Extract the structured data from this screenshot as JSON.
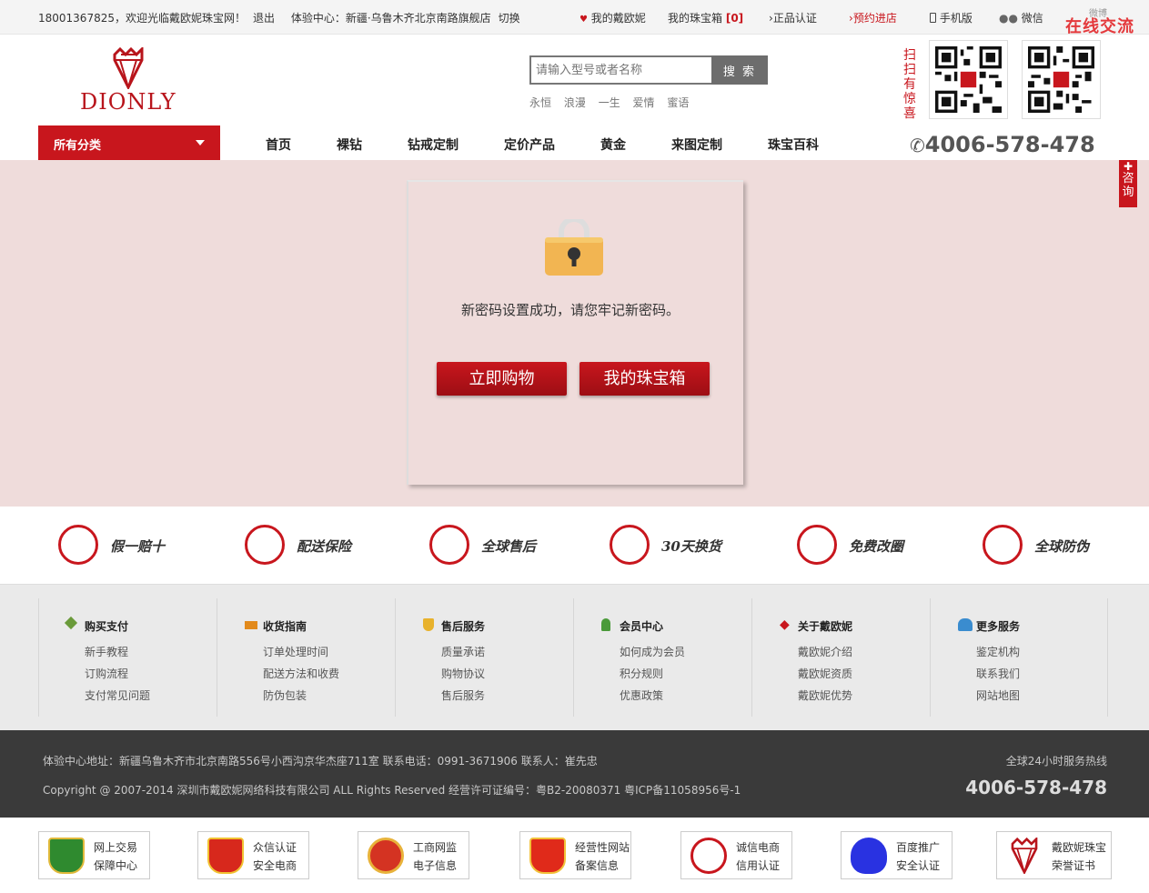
{
  "topbar": {
    "phone_user": "18001367825，欢迎光临戴欧妮珠宝网！",
    "logout": "退出",
    "experience": "体验中心：新疆·乌鲁木齐北京南路旗舰店",
    "switch": "切换",
    "my_dionly": "我的戴欧妮",
    "jewelry_box": "我的珠宝箱",
    "box_count": "[0]",
    "authentic": "正品认证",
    "appointment": "预约进店",
    "mobile": "手机版",
    "wechat": "微信",
    "weibo": "微博",
    "online_chat": "在线交流"
  },
  "header": {
    "logo_text": "DIONLY",
    "search_placeholder": "请输入型号或者名称",
    "search_button": "搜 索",
    "hot_words": [
      "永恒",
      "浪漫",
      "一生",
      "爱情",
      "蜜语"
    ],
    "scan_text": "扫扫有惊喜"
  },
  "nav": {
    "all_categories": "所有分类",
    "items": [
      "首页",
      "裸钻",
      "钻戒定制",
      "定价产品",
      "黄金",
      "来图定制",
      "珠宝百科"
    ],
    "phone": "4006-578-478"
  },
  "main": {
    "message": "新密码设置成功，请您牢记新密码。",
    "btn_shop": "立即购物",
    "btn_box": "我的珠宝箱",
    "side_consult": "咨询"
  },
  "guarantees": [
    "假一赔十",
    "配送保险",
    "全球售后",
    "30天换货",
    "免费改圈",
    "全球防伪"
  ],
  "footer_columns": [
    {
      "title": "购买支付",
      "links": [
        "新手教程",
        "订购流程",
        "支付常见问题"
      ]
    },
    {
      "title": "收货指南",
      "links": [
        "订单处理时间",
        "配送方法和收费",
        "防伪包装"
      ]
    },
    {
      "title": "售后服务",
      "links": [
        "质量承诺",
        "购物协议",
        "售后服务"
      ]
    },
    {
      "title": "会员中心",
      "links": [
        "如何成为会员",
        "积分规则",
        "优惠政策"
      ]
    },
    {
      "title": "关于戴欧妮",
      "links": [
        "戴欧妮介绍",
        "戴欧妮资质",
        "戴欧妮优势"
      ]
    },
    {
      "title": "更多服务",
      "links": [
        "鉴定机构",
        "联系我们",
        "网站地图"
      ]
    }
  ],
  "footer": {
    "address": "体验中心地址：新疆乌鲁木齐市北京南路556号小西沟京华杰座711室 联系电话：0991-3671906 联系人：崔先忠",
    "copyright": "Copyright @ 2007-2014 深圳市戴欧妮网络科技有限公司 ALL Rights Reserved 经营许可证编号：粤B2-20080371 粤ICP备11058956号-1",
    "hotline_label": "全球24小时服务热线",
    "hotline": "4006-578-478"
  },
  "badges": [
    {
      "l1": "网上交易",
      "l2": "保障中心"
    },
    {
      "l1": "众信认证",
      "l2": "安全电商"
    },
    {
      "l1": "工商网监",
      "l2": "电子信息"
    },
    {
      "l1": "经营性网站",
      "l2": "备案信息"
    },
    {
      "l1": "诚信电商",
      "l2": "信用认证"
    },
    {
      "l1": "百度推广",
      "l2": "安全认证"
    },
    {
      "l1": "戴欧妮珠宝",
      "l2": "荣誉证书"
    }
  ],
  "colors": {
    "brand_red": "#c8161d",
    "banner_bg": "#efdcdb",
    "footer_dark": "#3a3a3a"
  }
}
